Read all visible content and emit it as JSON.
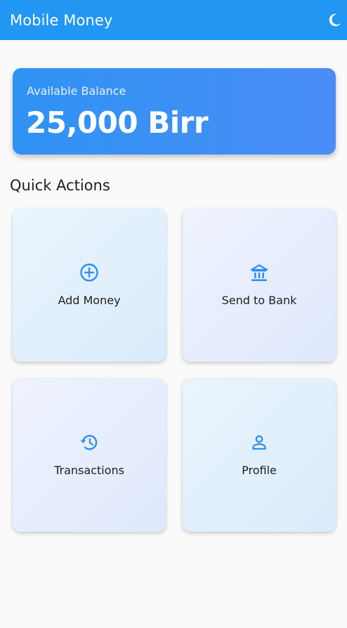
{
  "app": {
    "title": "Mobile Money",
    "theme_toggle_icon": "moon-icon"
  },
  "balance": {
    "label": "Available Balance",
    "amount": "25,000 Birr"
  },
  "quick_actions": {
    "title": "Quick Actions",
    "items": [
      {
        "label": "Add Money",
        "icon": "add-circle-icon"
      },
      {
        "label": "Send to Bank",
        "icon": "bank-icon"
      },
      {
        "label": "Transactions",
        "icon": "history-icon"
      },
      {
        "label": "Profile",
        "icon": "person-icon"
      }
    ]
  },
  "colors": {
    "primary": "#2196f3",
    "icon_accent": "#2f8ef2"
  }
}
